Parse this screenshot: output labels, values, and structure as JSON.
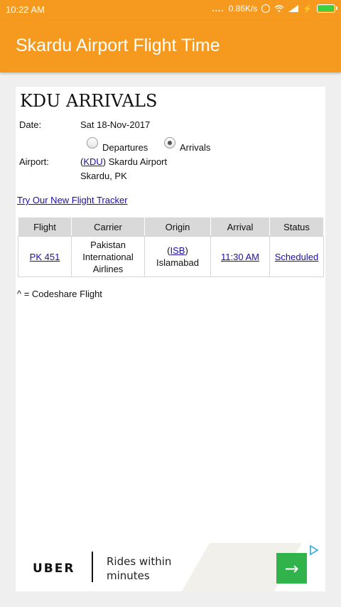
{
  "status_bar": {
    "time": "10:22 AM",
    "dots": "....",
    "speed": "0.86K/s",
    "icons": [
      "alarm-icon",
      "wifi-icon",
      "signal-icon",
      "charging-icon",
      "battery-icon"
    ]
  },
  "app_bar": {
    "title": "Skardu Airport Flight Time",
    "color": "#f59a1e"
  },
  "page": {
    "heading": "KDU ARRIVALS",
    "date_label": "Date:",
    "date_value": "Sat 18-Nov-2017",
    "radio_departures": "Departures",
    "radio_arrivals": "Arrivals",
    "selected_mode": "Arrivals",
    "airport_label": "Airport:",
    "airport_code": "KDU",
    "airport_name": ") Skardu Airport",
    "airport_paren_open": "(",
    "airport_city": "Skardu, PK",
    "tracker_link": "Try Our New Flight Tracker",
    "codeshare_note": "^ = Codeshare Flight",
    "link_color": "#1a0dab"
  },
  "table": {
    "headers": [
      "Flight",
      "Carrier",
      "Origin",
      "Arrival",
      "Status"
    ],
    "rows": [
      {
        "flight": "PK 451",
        "carrier": "Pakistan International Airlines",
        "origin_code": "ISB",
        "origin_city": "Islamabad",
        "arrival": "11:30 AM",
        "status": "Scheduled"
      }
    ]
  },
  "ad": {
    "brand": "UBER",
    "tagline": "Rides within minutes",
    "cta_icon": "arrow-right-icon",
    "cta_color": "#2fb34a",
    "adchoices_icon": "adchoices-icon"
  }
}
